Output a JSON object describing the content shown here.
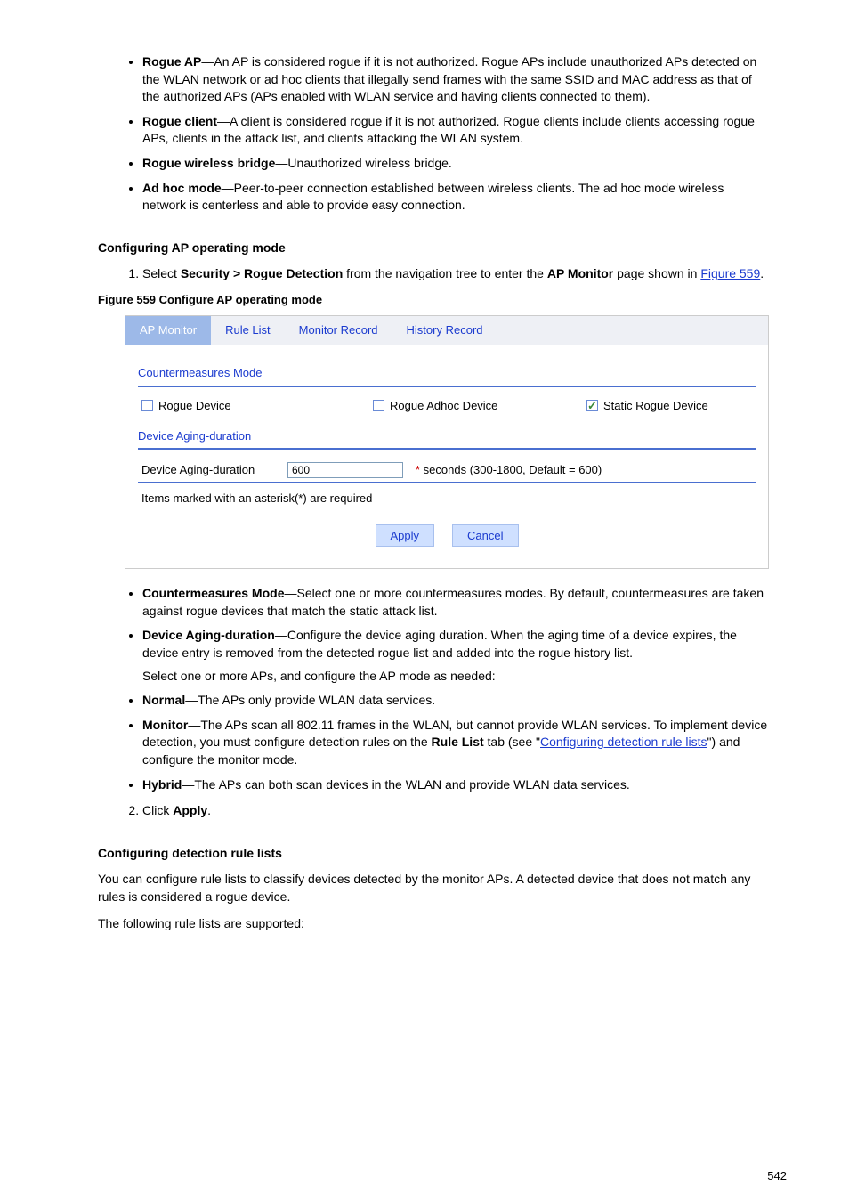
{
  "top_bullets": [
    {
      "title": "Rogue AP",
      "desc": "—An AP is considered rogue if it is not authorized. Rogue APs include unauthorized APs detected on the WLAN network or ad hoc clients that illegally send frames with the same SSID and MAC address as that of the authorized APs (APs enabled with WLAN service and having clients connected to them)."
    },
    {
      "title": "Rogue client",
      "desc": "—A client is considered rogue if it is not authorized. Rogue clients include clients accessing rogue APs, clients in the attack list, and clients attacking the WLAN system."
    },
    {
      "title": "Rogue wireless bridge",
      "desc": "—Unauthorized wireless bridge."
    },
    {
      "title": "Ad hoc mode",
      "desc": "—Peer-to-peer connection established between wireless clients. The ad hoc mode wireless network is centerless and able to provide easy connection."
    }
  ],
  "config_title": "Configuring AP operating mode",
  "config_steps_pre": "Select",
  "config_nav": "Security > Rogue Detection",
  "config_steps_mid": "from the navigation tree to enter the",
  "config_tab": "AP Monitor",
  "config_steps_end": "page shown in",
  "config_link": "Figure 559",
  "figure_caption": "Figure 559 Configure AP operating mode",
  "screenshot": {
    "tabs": [
      "AP Monitor",
      "Rule List",
      "Monitor Record",
      "History Record"
    ],
    "active_tab": 0,
    "section1": "Countermeasures Mode",
    "checkboxes": [
      {
        "label": "Rogue Device",
        "checked": false
      },
      {
        "label": "Rogue Adhoc Device",
        "checked": false
      },
      {
        "label": "Static Rogue Device",
        "checked": true
      }
    ],
    "section2": "Device Aging-duration",
    "aging_label": "Device Aging-duration",
    "aging_value": "600",
    "aging_hint": "seconds (300-1800, Default = 600)",
    "required_note": "Items marked with an asterisk(*) are required",
    "apply": "Apply",
    "cancel": "Cancel"
  },
  "mid_bullets": [
    {
      "title": "Countermeasures Mode",
      "desc": "—Select one or more countermeasures modes. By default, countermeasures are taken against rogue devices that match the static attack list."
    },
    {
      "title": "Device Aging-duration",
      "desc": "—Configure the device aging duration. When the aging time of a device expires, the device entry is removed from the detected rogue list and added into the rogue history list.",
      "sub": "Select one or more APs, and configure the AP mode as needed:"
    },
    {
      "title": "Normal",
      "desc": "—The APs only provide WLAN data services."
    },
    {
      "title": "Monitor",
      "desc": "—The APs scan all 802.11 frames in the WLAN, but cannot provide WLAN services. To implement device detection, you must configure detection rules on the ",
      "link_text": "Rule List",
      "desc2": " tab (see \"",
      "link2": "Configuring detection rule lists",
      "desc3": "\") and configure the monitor mode."
    },
    {
      "title": "Hybrid",
      "desc": "—The APs can both scan devices in the WLAN and provide WLAN data services."
    }
  ],
  "click_apply": "Click Apply.",
  "rule_title": "Configuring detection rule lists",
  "rule_para1": "You can configure rule lists to classify devices detected by the monitor APs. A detected device that does not match any rules is considered a rogue device.",
  "rule_sub": "The following rule lists are supported:",
  "page_number": "542"
}
